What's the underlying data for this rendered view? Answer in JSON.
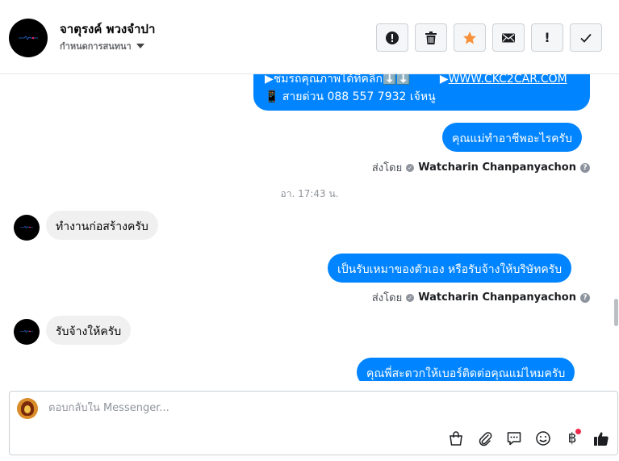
{
  "header": {
    "contact_name": "จาตุรงค์ พวงจำปา",
    "manage_label": "กำหนดการสนทนา",
    "toolbar": [
      {
        "name": "report-spam-button",
        "icon": "alert-circle-icon"
      },
      {
        "name": "delete-button",
        "icon": "trash-icon"
      },
      {
        "name": "star-button",
        "icon": "star-icon"
      },
      {
        "name": "email-button",
        "icon": "envelope-icon"
      },
      {
        "name": "mark-important-button",
        "icon": "exclamation-icon",
        "glyph": "!"
      },
      {
        "name": "mark-done-button",
        "icon": "checkmark-icon"
      }
    ]
  },
  "messages": {
    "first_bubble": {
      "line1_prefix": "▶ชมรถคุณภาพได้ที่คลิก⬇️⬇️",
      "line1_link_prefix": "▶",
      "line1_link": "WWW.CKC2CAR.COM",
      "line2": "📱 สายด่วน 088 557 7932 เจ้หนู"
    },
    "out1": "คุณแม่ทำอาชีพอะไรครับ",
    "sent_by_label": "ส่งโดย",
    "sent_by_name": "Watcharin Chanpanyachon",
    "timestamp": "อา. 17:43 น.",
    "in1": "ทำงานก่อสร้างครับ",
    "out2": "เป็นรับเหมาของตัวเอง หรือรับจ้างให้บริษัทครับ",
    "in2": "รับจ้างให้ครับ",
    "out3": "คุณพี่สะดวกให้เบอร์ติดต่อคุณแม่ไหมครับ"
  },
  "composer": {
    "placeholder": "ตอบกลับใน Messenger...",
    "baht_glyph": "฿"
  },
  "colors": {
    "outgoing": "#0084ff",
    "incoming": "#f0f0f0",
    "star": "#f7923b",
    "notification": "#f02849"
  }
}
